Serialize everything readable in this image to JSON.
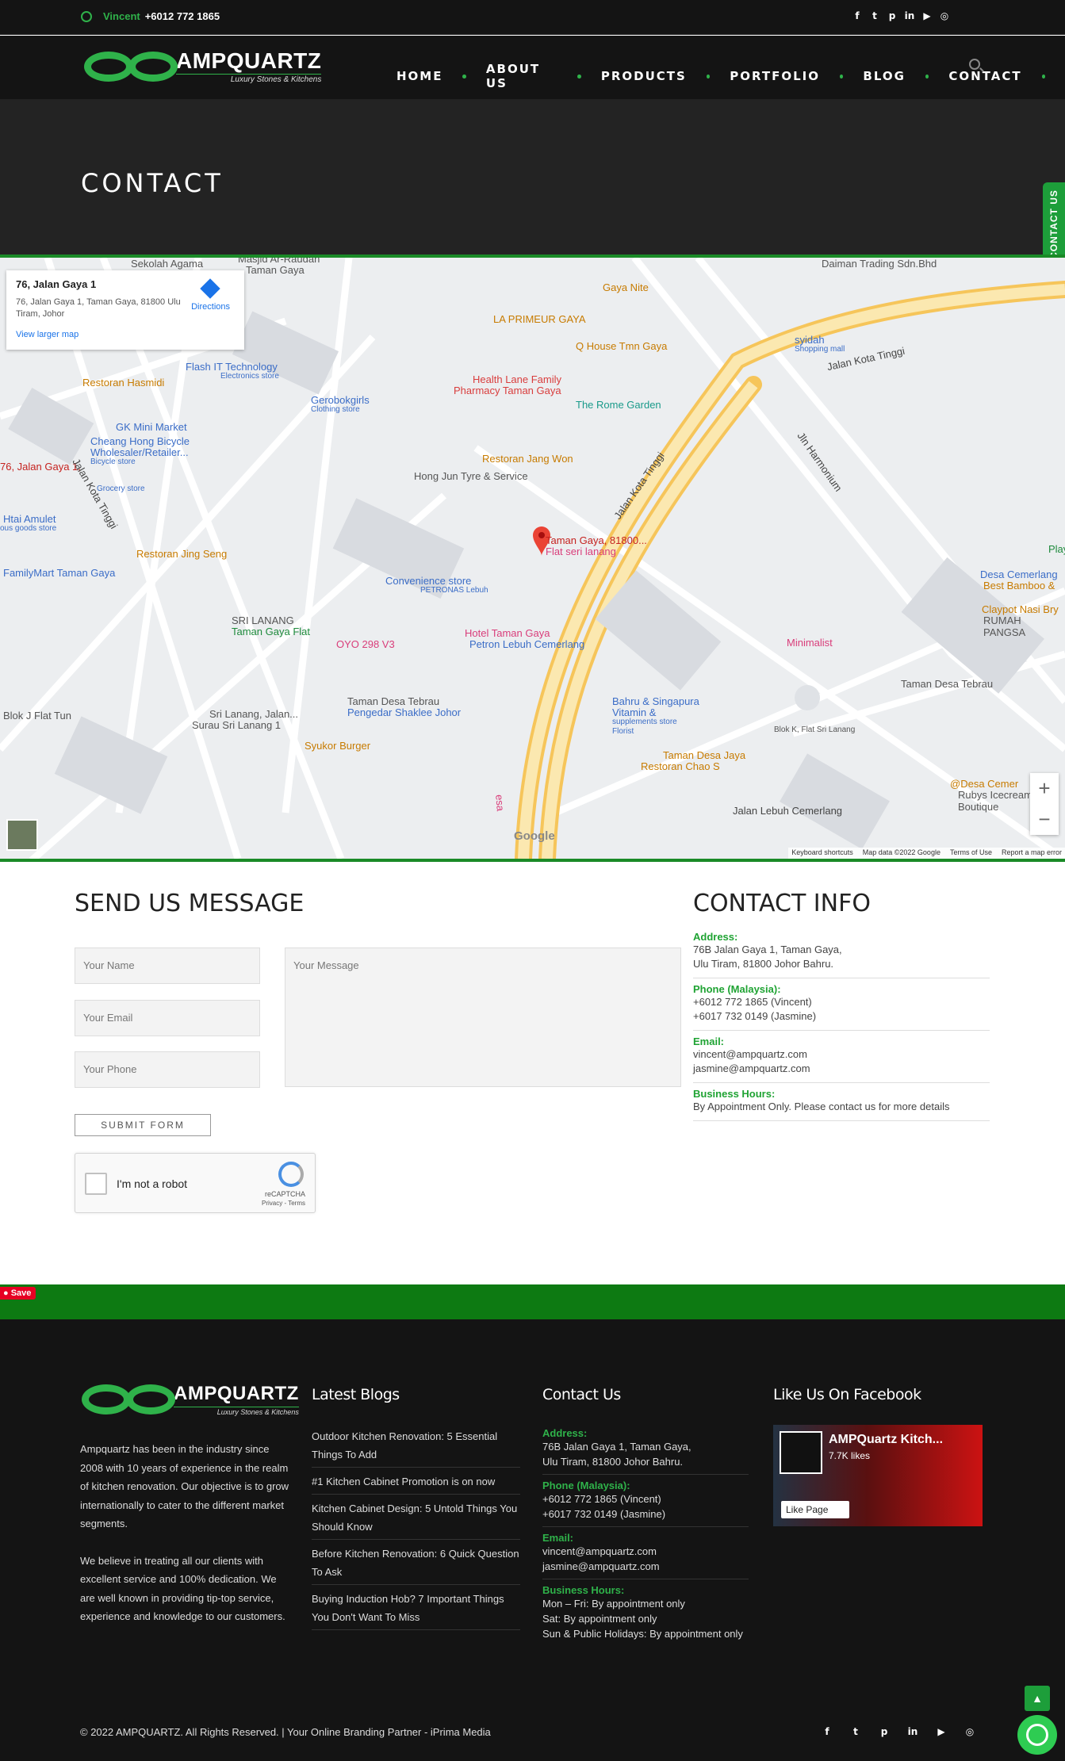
{
  "topbar": {
    "contact_name": "Vincent",
    "contact_phone": "+6012 772 1865"
  },
  "social_icons": [
    "facebook-icon",
    "twitter-icon",
    "pinterest-icon",
    "linkedin-icon",
    "youtube-icon",
    "instagram-icon"
  ],
  "brand": {
    "name": "AMPQUARTZ",
    "tagline": "Luxury Stones & Kitchens",
    "accent": "#2fb24a"
  },
  "nav": {
    "items": [
      "HOME",
      "ABOUT US",
      "PRODUCTS",
      "PORTFOLIO",
      "BLOG",
      "CONTACT"
    ]
  },
  "hero": {
    "title": "CONTACT"
  },
  "side_tab": {
    "label": "CONTACT US"
  },
  "map": {
    "card_title": "76, Jalan Gaya 1",
    "card_address": "76, Jalan Gaya 1, Taman Gaya, 81800 Ulu Tiram, Johor",
    "directions": "Directions",
    "larger_map": "View larger map",
    "labels": [
      {
        "t": "Sekolah Agama",
        "c": "#555"
      },
      {
        "t": "Masjid Ar-Raudah",
        "c": "#555"
      },
      {
        "t": "Taman Gaya",
        "c": "#555"
      },
      {
        "t": "Gaya Nite",
        "c": "#c77b00"
      },
      {
        "t": "LA PRIMEUR GAYA",
        "c": "#c77b00"
      },
      {
        "t": "Q House Tmn Gaya",
        "c": "#c77b00"
      },
      {
        "t": "Daiman Trading Sdn.Bhd",
        "c": "#555"
      },
      {
        "t": "syidah",
        "c": "#3b6dc7"
      },
      {
        "t": "Shopping mall",
        "c": "#3b6dc7"
      },
      {
        "t": "Jalan Kota Tinggi",
        "c": "#444"
      },
      {
        "t": "Restoran Hasmidi",
        "c": "#c77b00"
      },
      {
        "t": "Flash IT Technology",
        "c": "#3b6dc7"
      },
      {
        "t": "Electronics store",
        "c": "#3b6dc7"
      },
      {
        "t": "Gerobokgirls",
        "c": "#3b6dc7"
      },
      {
        "t": "Clothing store",
        "c": "#3b6dc7"
      },
      {
        "t": "Health Lane Family",
        "c": "#d93d3d"
      },
      {
        "t": "Pharmacy Taman Gaya",
        "c": "#d93d3d"
      },
      {
        "t": "The Rome Garden",
        "c": "#1a9a8a"
      },
      {
        "t": "GK Mini Market",
        "c": "#3b6dc7"
      },
      {
        "t": "Cheang Hong Bicycle",
        "c": "#3b6dc7"
      },
      {
        "t": "Wholesaler/Retailer...",
        "c": "#3b6dc7"
      },
      {
        "t": "Bicycle store",
        "c": "#3b6dc7"
      },
      {
        "t": "Restoran Jang Won",
        "c": "#c77b00"
      },
      {
        "t": "Hong Jun Tyre & Service",
        "c": "#555"
      },
      {
        "t": "Grocery store",
        "c": "#3b6dc7"
      },
      {
        "t": "Htai Amulet",
        "c": "#3b6dc7"
      },
      {
        "t": "ous goods store",
        "c": "#3b6dc7"
      },
      {
        "t": "76, Jalan Gaya 1,",
        "c": "#c5221f"
      },
      {
        "t": "Taman Gaya, 81800...",
        "c": "#c5221f"
      },
      {
        "t": "Flat seri lanang",
        "c": "#d93d7a"
      },
      {
        "t": "Restoran Jing Seng",
        "c": "#c77b00"
      },
      {
        "t": "FamilyMart Taman Gaya",
        "c": "#3b6dc7"
      },
      {
        "t": "Convenience store",
        "c": "#3b6dc7"
      },
      {
        "t": "PETRONAS Lebuh",
        "c": "#3b6dc7"
      },
      {
        "t": "Desa Cemerlang",
        "c": "#3b6dc7"
      },
      {
        "t": "Best Bamboo &",
        "c": "#c77b00"
      },
      {
        "t": "Claypot Nasi Bry",
        "c": "#c77b00"
      },
      {
        "t": "RUMAH PANGSA",
        "c": "#555"
      },
      {
        "t": "SRI LANANG",
        "c": "#555"
      },
      {
        "t": "Taman Gaya Flat",
        "c": "#1e8a3c"
      },
      {
        "t": "OYO 298 V3",
        "c": "#d93d7a"
      },
      {
        "t": "Hotel Taman Gaya",
        "c": "#d93d7a"
      },
      {
        "t": "Petron Lebuh Cemerlang",
        "c": "#3b6dc7"
      },
      {
        "t": "Minimalist",
        "c": "#d93d7a"
      },
      {
        "t": "Taman Desa Tebrau",
        "c": "#555"
      },
      {
        "t": "Blok J Flat Tun",
        "c": "#555"
      },
      {
        "t": "Sri Lanang, Jalan...",
        "c": "#555"
      },
      {
        "t": "Surau Sri Lanang 1",
        "c": "#555"
      },
      {
        "t": "Taman Desa Tebrau",
        "c": "#555"
      },
      {
        "t": "Pengedar Shaklee Johor",
        "c": "#3b6dc7"
      },
      {
        "t": "Bahru & Singapura",
        "c": "#3b6dc7"
      },
      {
        "t": "Vitamin &",
        "c": "#3b6dc7"
      },
      {
        "t": "supplements store",
        "c": "#3b6dc7"
      },
      {
        "t": "Florist",
        "c": "#3b6dc7"
      },
      {
        "t": "Blok K, Flat Sri Lanang",
        "c": "#555"
      },
      {
        "t": "Syukor Burger",
        "c": "#c77b00"
      },
      {
        "t": "Taman Desa Jaya",
        "c": "#c77b00"
      },
      {
        "t": "Restoran Chao S",
        "c": "#c77b00"
      },
      {
        "t": "@Desa Cemer",
        "c": "#c77b00"
      },
      {
        "t": "Rubys Icecream Boutique",
        "c": "#555"
      },
      {
        "t": "Jalan Lebuh Cemerlang",
        "c": "#444"
      },
      {
        "t": "Jln Harmonium",
        "c": "#444"
      },
      {
        "t": "Jalan Kota Tinggi",
        "c": "#444"
      },
      {
        "t": "Jalan Kota Tinggi",
        "c": "#444"
      },
      {
        "t": "esa",
        "c": "#d93d7a"
      },
      {
        "t": "Play",
        "c": "#1e8a3c"
      }
    ],
    "footer_items": [
      "Keyboard shortcuts",
      "Map data ©2022 Google",
      "Terms of Use",
      "Report a map error"
    ],
    "google": "Google"
  },
  "form": {
    "title": "SEND US MESSAGE",
    "name_placeholder": "Your Name",
    "email_placeholder": "Your Email",
    "phone_placeholder": "Your Phone",
    "message_placeholder": "Your Message",
    "submit": "SUBMIT FORM",
    "captcha_label": "I'm not a robot",
    "captcha_brand": "reCAPTCHA",
    "captcha_links": "Privacy - Terms"
  },
  "contact_info": {
    "title": "CONTACT INFO",
    "address_label": "Address:",
    "address_1": "76B Jalan Gaya 1, Taman Gaya,",
    "address_2": "Ulu Tiram, 81800 Johor Bahru.",
    "phone_label": "Phone (Malaysia):",
    "phone_1": "+6012 772 1865 (Vincent)",
    "phone_2": "+6017 732 0149 (Jasmine)",
    "email_label": "Email:",
    "email_1": "vincent@ampquartz.com",
    "email_2": "jasmine@ampquartz.com",
    "hours_label": "Business Hours:",
    "hours": "By Appointment Only. Please contact us for more details"
  },
  "pinterest_save": "Save",
  "footer": {
    "about_p1": "Ampquartz has been in the industry since 2008 with 10 years of experience in the realm of kitchen renovation. Our objective is to grow internationally to cater to the different market segments.",
    "about_p2": "We believe in treating all our clients with excellent service and 100% dedication. We are well known in providing tip-top service, experience and knowledge to our customers.",
    "blogs_title": "Latest Blogs",
    "blogs": [
      "Outdoor Kitchen Renovation: 5 Essential Things To Add",
      "#1 Kitchen Cabinet Promotion is on now",
      "Kitchen Cabinet Design: 5 Untold Things You Should Know",
      "Before Kitchen Renovation: 6 Quick Question To Ask",
      "Buying Induction Hob? 7 Important Things You Don't Want To Miss"
    ],
    "contact_title": "Contact Us",
    "address_label": "Address:",
    "address_1": "76B Jalan Gaya 1, Taman Gaya,",
    "address_2": "Ulu Tiram, 81800 Johor Bahru.",
    "phone_label": "Phone (Malaysia):",
    "phone_1": "+6012 772 1865 (Vincent)",
    "phone_2": "+6017 732 0149 (Jasmine)",
    "email_label": "Email:",
    "email_1": "vincent@ampquartz.com",
    "email_2": "jasmine@ampquartz.com",
    "hours_label": "Business Hours:",
    "hours_1": "Mon – Fri: By appointment only",
    "hours_2": "Sat: By appointment only",
    "hours_3": "Sun & Public Holidays: By appointment only",
    "facebook_title": "Like Us On Facebook",
    "fb_page": "AMPQuartz Kitch...",
    "fb_likes": "7.7K likes",
    "fb_like_btn": "Like Page",
    "copyright": "© 2022 AMPQUARTZ. All Rights Reserved. | Your Online Branding Partner - iPrima Media"
  }
}
